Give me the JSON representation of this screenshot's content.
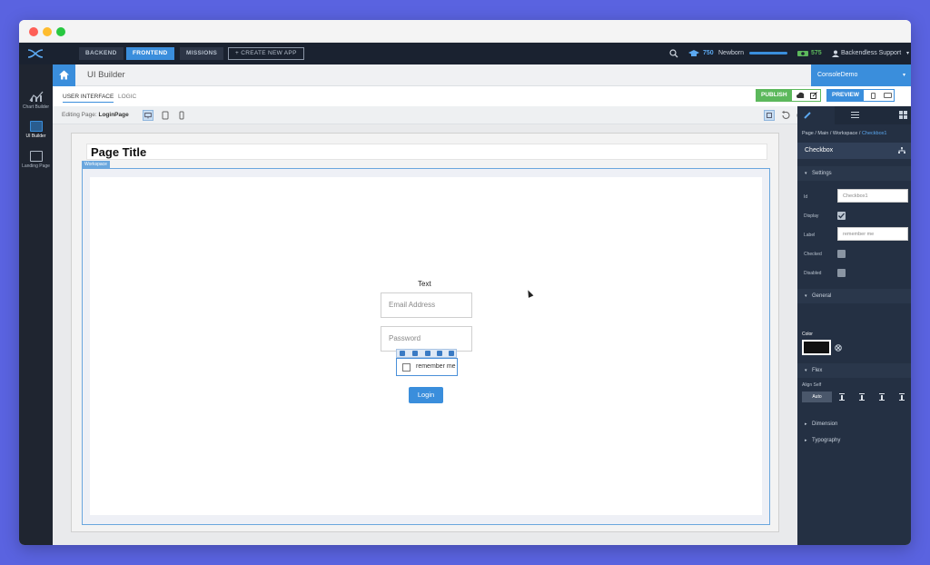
{
  "topnav": {
    "tabs": [
      "BACKEND",
      "FRONTEND",
      "MISSIONS"
    ],
    "create_app": "+ CREATE NEW APP",
    "points": "750",
    "level": "Newborn",
    "credits": "575",
    "user": "Backendless Support"
  },
  "subheader": {
    "title": "UI Builder",
    "app_name": "ConsoleDemo"
  },
  "leftbar": {
    "items": [
      "Chart Builder",
      "UI Builder",
      "Landing Page"
    ]
  },
  "tabs": {
    "user_interface": "USER INTERFACE",
    "logic": "LOGIC",
    "publish": "PUBLISH",
    "preview": "PREVIEW"
  },
  "editing": {
    "prefix": "Editing Page:",
    "page": "LoginPage"
  },
  "canvas": {
    "page_title": "Page Title",
    "workspace_label": "Workspace",
    "text": "Text",
    "email_placeholder": "Email Address",
    "password_placeholder": "Password",
    "checkbox_label": "remember me",
    "login_button": "Login"
  },
  "right_panel": {
    "path_prefix": "Page / Main / Workspace /",
    "path_current": "Checkbox1",
    "selected": "Checkbox",
    "sections": {
      "settings": "Settings",
      "general": "General",
      "flex": "Flex",
      "dimension": "Dimension",
      "typography": "Typography"
    },
    "fields": {
      "id_label": "Id",
      "id_value": "Checkbox1",
      "display_label": "Display",
      "label_label": "Label",
      "label_value": "remember me",
      "checked_label": "Checked",
      "disabled_label": "Disabled",
      "color_label": "Color",
      "align_self_label": "Align Self",
      "align_auto": "Auto"
    },
    "color_value": "#111111"
  }
}
